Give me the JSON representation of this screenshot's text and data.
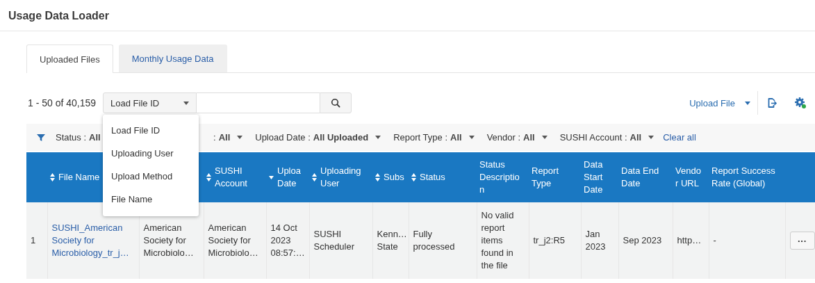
{
  "page": {
    "title": "Usage Data Loader"
  },
  "tabs": [
    {
      "label": "Uploaded Files",
      "selected": true
    },
    {
      "label": "Monthly Usage Data",
      "selected": false
    }
  ],
  "toolbar": {
    "count": "1 - 50 of 40,159",
    "search_by": "Load File ID",
    "upload_button": "Upload File"
  },
  "search_by_menu": {
    "items": [
      "Load File ID",
      "Uploading User",
      "Upload Method",
      "File Name"
    ]
  },
  "filters": [
    {
      "label": "Status :",
      "value": "All",
      "caret": false
    },
    {
      "label": ":",
      "value": "All",
      "caret": true
    },
    {
      "label": "Upload Date :",
      "value": "All Uploaded",
      "caret": true
    },
    {
      "label": "Report Type :",
      "value": "All",
      "caret": true
    },
    {
      "label": "Vendor :",
      "value": "All",
      "caret": true
    },
    {
      "label": "SUSHI Account :",
      "value": "All",
      "caret": true
    }
  ],
  "clear_all": "Clear all",
  "table": {
    "columns": [
      {
        "sortable": false,
        "descending": false
      },
      {
        "label": "File Name",
        "sortable": true,
        "descending": false
      },
      {
        "sortable": false,
        "descending": false
      },
      {
        "label": "SUSHI Account",
        "sortable": true,
        "descending": false
      },
      {
        "label": "Uploa Date",
        "sortable": true,
        "descending": true
      },
      {
        "label": "Uploading User",
        "sortable": true,
        "descending": false
      },
      {
        "label": "Subs",
        "sortable": true,
        "descending": false
      },
      {
        "label": "Status",
        "sortable": true,
        "descending": false
      },
      {
        "label": "Status Descriptio n",
        "sortable": false,
        "descending": false
      },
      {
        "label": "Report Type",
        "sortable": false,
        "descending": false
      },
      {
        "label": "Data Start Date",
        "sortable": false,
        "descending": false
      },
      {
        "label": "Data End Date",
        "sortable": false,
        "descending": false
      },
      {
        "label": "Vendo r URL",
        "sortable": false,
        "descending": false
      },
      {
        "label": "Report Success Rate (Global)",
        "sortable": false,
        "descending": false
      },
      {
        "sortable": false,
        "descending": false
      }
    ],
    "rows": [
      {
        "cells": [
          {
            "kind": "text",
            "text": "1"
          },
          {
            "kind": "link",
            "text": "SUSHI_American Society for Microbiology_tr_j…"
          },
          {
            "kind": "text",
            "text": "American Society for Microbiolo…"
          },
          {
            "kind": "text",
            "text": "American Society for Microbiolo…"
          },
          {
            "kind": "text",
            "text": "14 Oct 2023 08:57:…"
          },
          {
            "kind": "text",
            "text": "SUSHI Scheduler"
          },
          {
            "kind": "text",
            "text": "Kenn… State"
          },
          {
            "kind": "text",
            "text": "Fully processed"
          },
          {
            "kind": "text",
            "text": "No valid report items found in the file"
          },
          {
            "kind": "text",
            "text": "tr_j2:R5"
          },
          {
            "kind": "text",
            "text": "Jan 2023"
          },
          {
            "kind": "text",
            "text": "Sep 2023"
          },
          {
            "kind": "text",
            "text": "http…"
          },
          {
            "kind": "text",
            "text": "-"
          },
          {
            "kind": "button",
            "text": "···"
          }
        ]
      }
    ]
  }
}
